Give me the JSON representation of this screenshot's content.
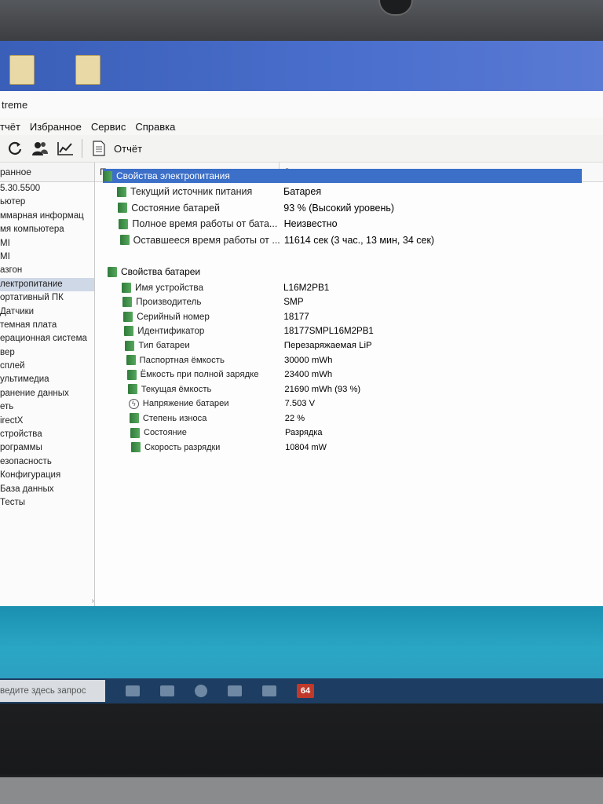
{
  "window": {
    "title": "treme"
  },
  "menu": [
    "тчёт",
    "Избранное",
    "Сервис",
    "Справка"
  ],
  "toolbar": {
    "report_label": "Отчёт"
  },
  "left_pane": {
    "header": "ранное",
    "items": [
      "5.30.5500",
      "ьютер",
      "ммарная информац",
      "мя компьютера",
      "MI",
      "MI",
      "азгон",
      "лектропитание",
      "ортативный ПК",
      "Датчики",
      "темная плата",
      "ерационная система",
      "вер",
      "сплей",
      "ультимедиа",
      "ранение данных",
      "еть",
      "irectX",
      "стройства",
      "рограммы",
      "езопасность",
      "Конфигурация",
      "База данных",
      "Тесты"
    ],
    "selected_index": 7,
    "scroll_arrow": "›"
  },
  "columns": {
    "field": "Поле",
    "value": "Значение"
  },
  "sections": [
    {
      "title": "Свойства электропитания",
      "rows": [
        {
          "field": "Текущий источник питания",
          "value": "Батарея"
        },
        {
          "field": "Состояние батарей",
          "value": "93 % (Высокий уровень)"
        },
        {
          "field": "Полное время работы от бата...",
          "value": "Неизвестно"
        },
        {
          "field": "Оставшееся время работы от ...",
          "value": "11614 сек (3 час., 13 мин, 34 сек)"
        }
      ]
    },
    {
      "title": "Свойства батареи",
      "rows": [
        {
          "field": "Имя устройства",
          "value": "L16M2PB1"
        },
        {
          "field": "Производитель",
          "value": "SMP"
        },
        {
          "field": "Серийный номер",
          "value": "18177"
        },
        {
          "field": "Идентификатор",
          "value": "18177SMPL16M2PB1"
        },
        {
          "field": "Тип батареи",
          "value": "Перезаряжаемая LiP"
        },
        {
          "field": "Паспортная ёмкость",
          "value": "30000 mWh"
        },
        {
          "field": "Ёмкость при полной зарядке",
          "value": "23400 mWh"
        },
        {
          "field": "Текущая ёмкость",
          "value": "21690 mWh  (93 %)"
        },
        {
          "field": "Напряжение батареи",
          "value": "7.503 V",
          "icon": "bolt"
        },
        {
          "field": "Степень износа",
          "value": "22 %"
        },
        {
          "field": "Состояние",
          "value": "Разрядка"
        },
        {
          "field": "Скорость разрядки",
          "value": "10804 mW"
        }
      ]
    }
  ],
  "taskbar": {
    "search_placeholder": "ведите здесь запрос",
    "app_badge": "64"
  },
  "colors": {
    "selection": "#3b6fc8",
    "battery_icon": "#3f8f48"
  }
}
